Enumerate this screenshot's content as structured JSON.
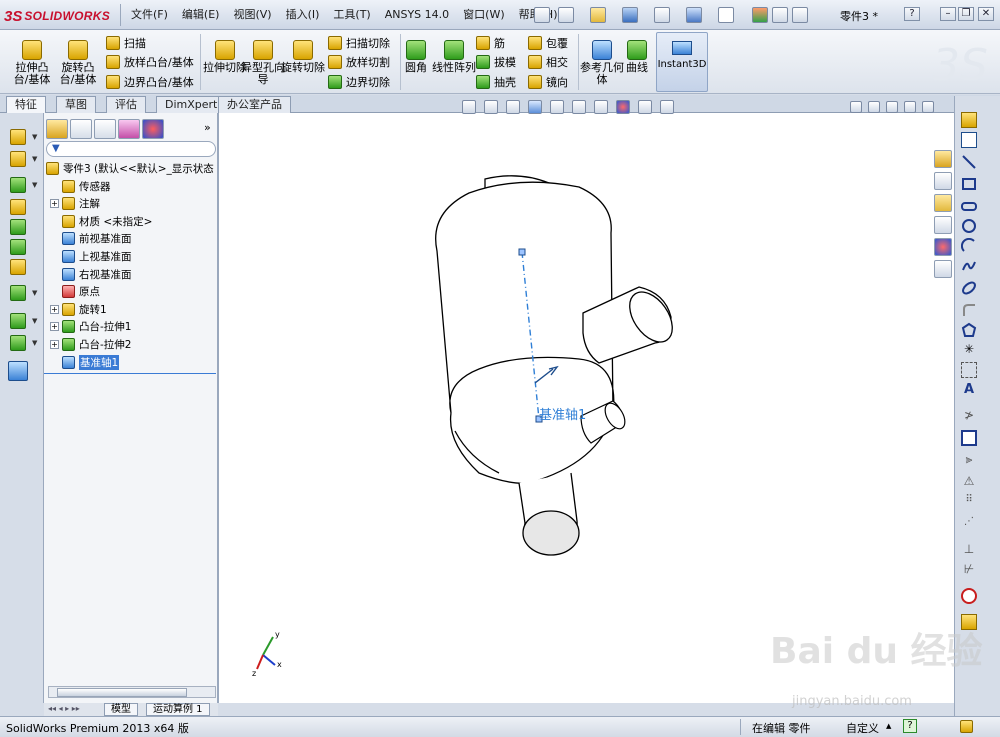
{
  "app": {
    "logo_prefix": "3S",
    "logo_text": "SOLIDWORKS",
    "doc_title": "零件3 *"
  },
  "menu": [
    "文件(F)",
    "编辑(E)",
    "视图(V)",
    "插入(I)",
    "工具(T)",
    "ANSYS 14.0",
    "窗口(W)",
    "帮助(H)"
  ],
  "window_controls": {
    "help": "?",
    "minimize": "–",
    "restore": "❐",
    "close": "✕"
  },
  "ribbon": {
    "extrude_boss": "拉伸凸台/基体",
    "revolve_boss": "旋转凸台/基体",
    "sweep": "扫描",
    "loft_boss": "放样凸台/基体",
    "boundary_boss": "边界凸台/基体",
    "extrude_cut": "拉伸切除",
    "hole_wizard": "异型孔向导",
    "revolve_cut": "旋转切除",
    "sweep_cut": "扫描切除",
    "loft_cut": "放样切割",
    "boundary_cut": "边界切除",
    "fillet": "圆角",
    "linear_pattern": "线性阵列",
    "rib": "筋",
    "draft": "拔模",
    "shell": "抽壳",
    "wrap": "包覆",
    "intersect": "相交",
    "mirror": "镜向",
    "ref_geometry": "参考几何体",
    "curves": "曲线",
    "instant3d": "Instant3D"
  },
  "tabs": [
    "特征",
    "草图",
    "评估",
    "DimXpert",
    "办公室产品"
  ],
  "feature_tree": {
    "root": "零件3 (默认<<默认>_显示状态",
    "items": [
      {
        "label": "传感器",
        "expand": false
      },
      {
        "label": "注解",
        "expand": true
      },
      {
        "label": "材质 <未指定>",
        "expand": false
      },
      {
        "label": "前视基准面",
        "expand": false
      },
      {
        "label": "上视基准面",
        "expand": false
      },
      {
        "label": "右视基准面",
        "expand": false
      },
      {
        "label": "原点",
        "expand": false
      },
      {
        "label": "旋转1",
        "expand": true
      },
      {
        "label": "凸台-拉伸1",
        "expand": true
      },
      {
        "label": "凸台-拉伸2",
        "expand": true
      },
      {
        "label": "基准轴1",
        "expand": false,
        "selected": true
      }
    ]
  },
  "bottom_tabs": [
    "模型",
    "运动算例 1"
  ],
  "viewport": {
    "axis_label": "基准轴1",
    "triad": {
      "x": "x",
      "y": "y",
      "z": "z"
    }
  },
  "status": {
    "app_version": "SolidWorks Premium 2013 x64 版",
    "mode": "在编辑 零件",
    "custom": "自定义",
    "help": "?"
  },
  "watermark": {
    "brand": "Bai du 经验",
    "url": "jingyan.baidu.com"
  }
}
